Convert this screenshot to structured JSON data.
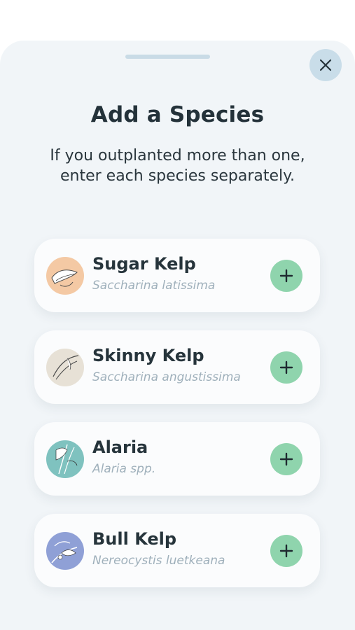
{
  "header": {
    "title": "Add a Species",
    "subtitle": "If you outplanted more than one, enter each species separately.",
    "close_icon": "close-icon"
  },
  "species": [
    {
      "name": "Sugar Kelp",
      "scientific": "Saccharina latissima",
      "thumb_bg": "#f4c9a4",
      "icon": "plus-icon"
    },
    {
      "name": "Skinny Kelp",
      "scientific": "Saccharina angustissima",
      "thumb_bg": "#e7e1d6",
      "icon": "plus-icon"
    },
    {
      "name": "Alaria",
      "scientific": "Alaria spp.",
      "thumb_bg": "#7fc2bf",
      "icon": "plus-icon"
    },
    {
      "name": "Bull Kelp",
      "scientific": "Nereocystis luetkeana",
      "thumb_bg": "#8fa0d6",
      "icon": "plus-icon"
    }
  ],
  "colors": {
    "sheet": "#f1f5f8",
    "accent_add": "#8fd4ad",
    "close_bg": "#c9dde9",
    "title": "#24323a",
    "scientific": "#9fb0bb"
  }
}
